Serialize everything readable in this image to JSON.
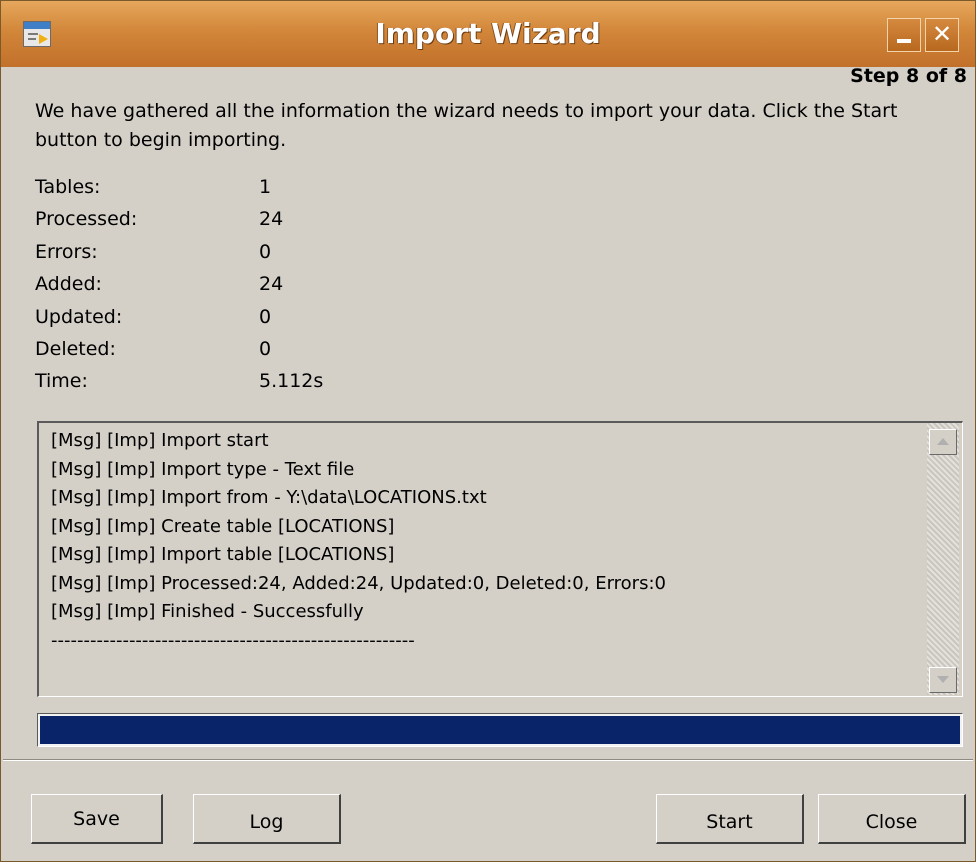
{
  "window": {
    "title": "Import Wizard",
    "icon": "import-wizard-app-icon",
    "controls": {
      "minimize_icon": "minimize-icon",
      "close_glyph": "✕"
    },
    "accent": "#d2873a"
  },
  "step_label": "Step 8 of 8",
  "intro_text": "We have gathered all the information the wizard needs to import your data. Click the Start button to begin importing.",
  "stats": [
    {
      "label": "Tables:",
      "value": "1"
    },
    {
      "label": "Processed:",
      "value": "24"
    },
    {
      "label": "Errors:",
      "value": "0"
    },
    {
      "label": "Added:",
      "value": "24"
    },
    {
      "label": "Updated:",
      "value": "0"
    },
    {
      "label": "Deleted:",
      "value": "0"
    },
    {
      "label": "Time:",
      "value": "5.112s"
    }
  ],
  "log": [
    "[Msg] [Imp] Import start",
    "[Msg] [Imp] Import type - Text file",
    "[Msg] [Imp] Import from - Y:\\data\\LOCATIONS.txt",
    "[Msg] [Imp] Create table [LOCATIONS]",
    "[Msg] [Imp] Import table [LOCATIONS]",
    "[Msg] [Imp] Processed:24, Added:24, Updated:0, Deleted:0, Errors:0",
    "[Msg] [Imp] Finished - Successfully",
    "--------------------------------------------------------"
  ],
  "progress": {
    "fraction": 1.0,
    "color": "#0a246a"
  },
  "buttons": {
    "save": "Save",
    "log": "Log",
    "start": "Start",
    "close": "Close"
  }
}
